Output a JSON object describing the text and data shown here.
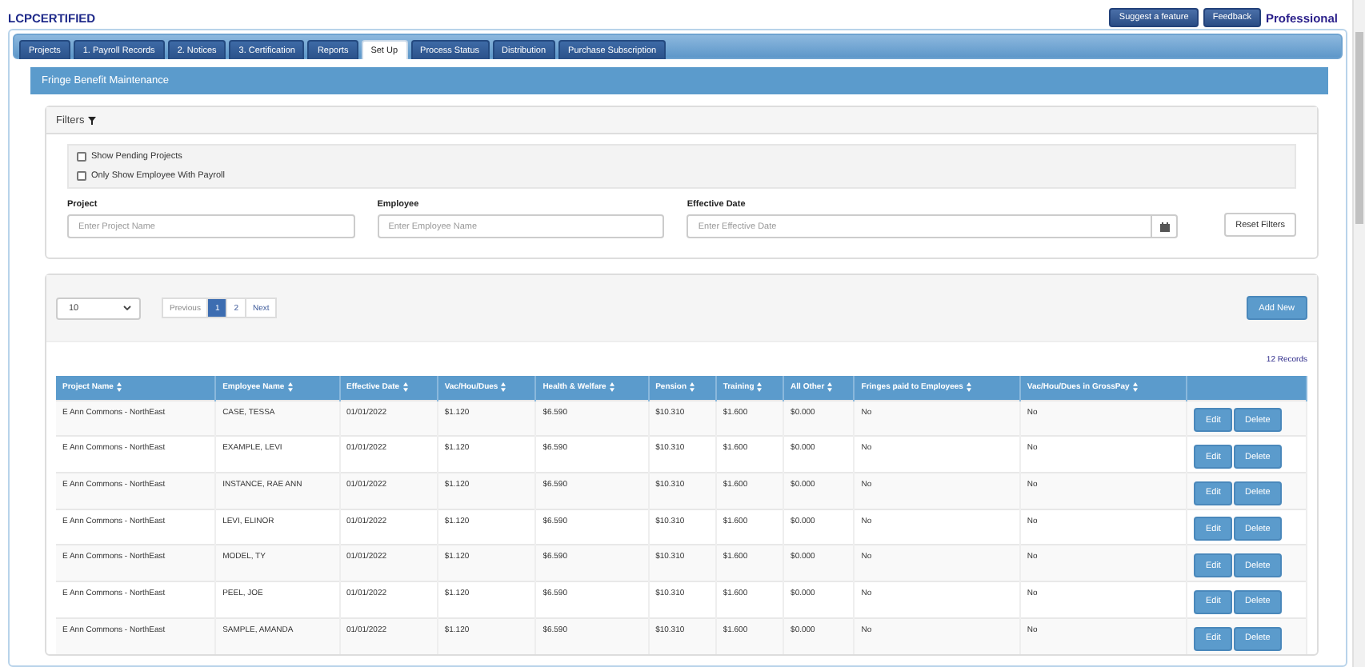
{
  "brand": "LCPCERTIFIED",
  "top_buttons": [
    "Suggest a feature",
    "Feedback"
  ],
  "plan": "Professional",
  "tabs": [
    {
      "label": "Projects",
      "selected": false
    },
    {
      "label": "1. Payroll Records",
      "selected": false
    },
    {
      "label": "2. Notices",
      "selected": false
    },
    {
      "label": "3. Certification",
      "selected": false
    },
    {
      "label": "Reports",
      "selected": false
    },
    {
      "label": "Set Up",
      "selected": true
    },
    {
      "label": "Process Status",
      "selected": false
    },
    {
      "label": "Distribution",
      "selected": false
    },
    {
      "label": "Purchase Subscription",
      "selected": false
    }
  ],
  "panel_title": "Fringe Benefit Maintenance",
  "filters": {
    "title": "Filters",
    "checkboxes": [
      {
        "label": "Show Pending Projects",
        "checked": false
      },
      {
        "label": "Only Show Employee With Payroll",
        "checked": false
      }
    ],
    "fields": [
      {
        "kind": "text",
        "label": "Project",
        "placeholder": "Enter Project Name"
      },
      {
        "kind": "text",
        "label": "Employee",
        "placeholder": "Enter Employee Name"
      },
      {
        "kind": "date",
        "label": "Effective Date",
        "placeholder": "Enter Effective Date"
      }
    ],
    "reset_button": "Reset Filters"
  },
  "list": {
    "page_size": "10",
    "pagination": {
      "previous": "Previous",
      "pages": [
        {
          "label": "1",
          "selected": true
        },
        {
          "label": "2",
          "selected": false
        }
      ],
      "next": "Next"
    },
    "add_button": "Add New",
    "record_count": "12 Records",
    "table": {
      "columns": [
        "Project Name",
        "Employee Name",
        "Effective Date",
        "Vac/Hou/Dues",
        "Health & Welfare",
        "Pension",
        "Training",
        "All Other",
        "Fringes paid to Employees",
        "Vac/Hou/Dues in GrossPay"
      ],
      "rows": [
        {
          "cells": [
            "E Ann Commons - NorthEast",
            "CASE, TESSA",
            "01/01/2022",
            "$1.120",
            "$6.590",
            "$10.310",
            "$1.600",
            "$0.000",
            "No",
            "No"
          ],
          "actions": [
            "Edit",
            "Delete"
          ]
        },
        {
          "cells": [
            "E Ann Commons - NorthEast",
            "EXAMPLE, LEVI",
            "01/01/2022",
            "$1.120",
            "$6.590",
            "$10.310",
            "$1.600",
            "$0.000",
            "No",
            "No"
          ],
          "actions": [
            "Edit",
            "Delete"
          ]
        },
        {
          "cells": [
            "E Ann Commons - NorthEast",
            "INSTANCE, RAE ANN",
            "01/01/2022",
            "$1.120",
            "$6.590",
            "$10.310",
            "$1.600",
            "$0.000",
            "No",
            "No"
          ],
          "actions": [
            "Edit",
            "Delete"
          ]
        },
        {
          "cells": [
            "E Ann Commons - NorthEast",
            "LEVI, ELINOR",
            "01/01/2022",
            "$1.120",
            "$6.590",
            "$10.310",
            "$1.600",
            "$0.000",
            "No",
            "No"
          ],
          "actions": [
            "Edit",
            "Delete"
          ]
        },
        {
          "cells": [
            "E Ann Commons - NorthEast",
            "MODEL, TY",
            "01/01/2022",
            "$1.120",
            "$6.590",
            "$10.310",
            "$1.600",
            "$0.000",
            "No",
            "No"
          ],
          "actions": [
            "Edit",
            "Delete"
          ]
        },
        {
          "cells": [
            "E Ann Commons - NorthEast",
            "PEEL, JOE",
            "01/01/2022",
            "$1.120",
            "$6.590",
            "$10.310",
            "$1.600",
            "$0.000",
            "No",
            "No"
          ],
          "actions": [
            "Edit",
            "Delete"
          ]
        },
        {
          "cells": [
            "E Ann Commons - NorthEast",
            "SAMPLE, AMANDA",
            "01/01/2022",
            "$1.120",
            "$6.590",
            "$10.310",
            "$1.600",
            "$0.000",
            "No",
            "No"
          ],
          "actions": [
            "Edit",
            "Delete"
          ]
        }
      ]
    }
  }
}
